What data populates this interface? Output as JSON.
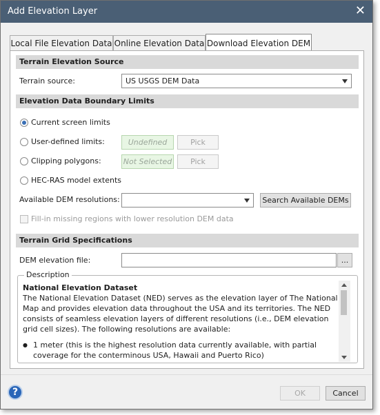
{
  "window": {
    "title": "Add Elevation Layer"
  },
  "tabs": [
    {
      "label": "Local File Elevation Data"
    },
    {
      "label": "Online Elevation Data"
    },
    {
      "label": "Download Elevation DEM"
    }
  ],
  "terrain_source_section": {
    "header": "Terrain Elevation Source",
    "label": "Terrain source:",
    "value": "US USGS DEM Data"
  },
  "boundary_section": {
    "header": "Elevation Data Boundary Limits",
    "options": {
      "current": "Current screen limits",
      "user_defined": "User-defined limits:",
      "clipping": "Clipping polygons:",
      "hecras": "HEC-RAS model extents"
    },
    "user_defined_value": "Undefined",
    "clipping_value": "Not Selected",
    "pick_label": "Pick",
    "resolutions_label": "Available DEM resolutions:",
    "resolutions_value": "",
    "search_button": "Search Available DEMs",
    "fill_in_label": "Fill-in missing regions with lower resolution DEM data"
  },
  "grid_section": {
    "header": "Terrain Grid Specifications",
    "dem_file_label": "DEM elevation file:",
    "dem_file_value": "",
    "browse_label": "..."
  },
  "description": {
    "legend": "Description",
    "title": "National Elevation Dataset",
    "body": "The National Elevation Dataset (NED) serves as the elevation layer of The National Map and provides elevation data throughout the USA and its territories. The NED consists of seamless elevation layers of different resolutions (i.e., DEM elevation grid cell sizes). The following resolutions are available:",
    "bullet_1": "1 meter (this is the highest resolution data currently available, with partial coverage for the conterminous USA, Hawaii and Puerto Rico)"
  },
  "footer": {
    "help_label": "?",
    "ok_label": "OK",
    "cancel_label": "Cancel"
  }
}
